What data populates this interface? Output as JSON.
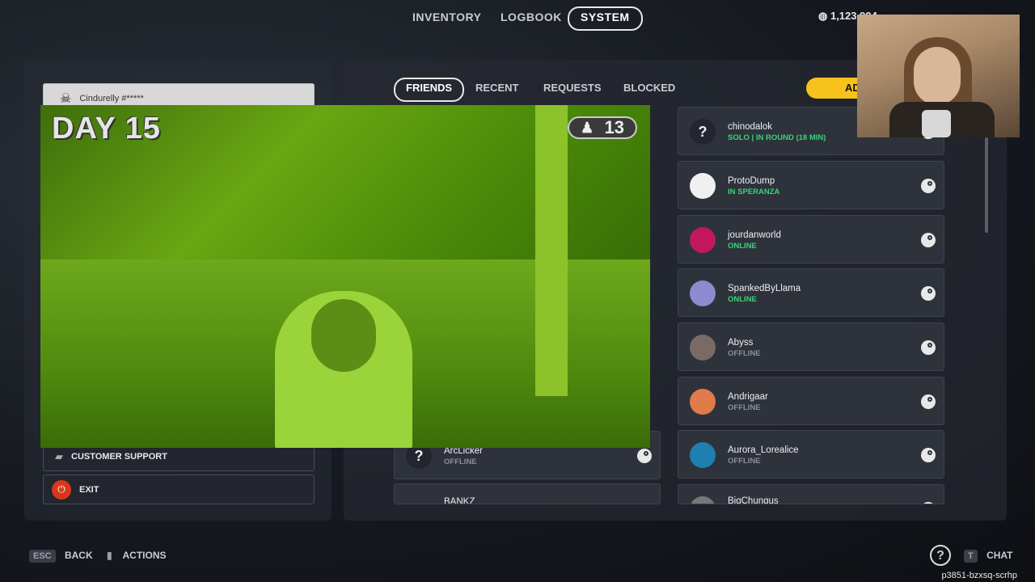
{
  "top_nav": {
    "tabs": [
      {
        "label": "INVENTORY",
        "active": false
      },
      {
        "label": "LOGBOOK",
        "active": false
      },
      {
        "label": "SYSTEM",
        "active": true
      }
    ],
    "currency": {
      "coins": "1,123,994"
    }
  },
  "left_panel": {
    "user": "Cindurelly #*****",
    "buttons": [
      {
        "label": "CUSTOMER SUPPORT",
        "icon": "chat-bubbles-icon"
      },
      {
        "label": "EXIT",
        "icon": "power-icon"
      }
    ]
  },
  "friends": {
    "tabs": [
      {
        "label": "FRIENDS",
        "active": true
      },
      {
        "label": "RECENT",
        "active": false
      },
      {
        "label": "REQUESTS",
        "active": false
      },
      {
        "label": "BLOCKED",
        "active": false
      }
    ],
    "add_label": "AD",
    "left_column": [
      {
        "name": "ArcLicker",
        "status": "OFFLINE"
      },
      {
        "name": "BANKZ",
        "status": ""
      }
    ],
    "right_column": [
      {
        "name": "chinodalok",
        "status": "SOLO | IN ROUND (18 MIN)",
        "status_color": "#3bd37a",
        "avatar": "?",
        "avatar_bg": "#23262e"
      },
      {
        "name": "ProtoDump",
        "status": "IN SPERANZA",
        "status_color": "#3bd37a",
        "avatar": "",
        "avatar_bg": "#f0f0f0"
      },
      {
        "name": "jourdanworld",
        "status": "ONLINE",
        "status_color": "#3bd37a",
        "avatar": "",
        "avatar_bg": "#c2185b"
      },
      {
        "name": "SpankedByLlama",
        "status": "ONLINE",
        "status_color": "#3bd37a",
        "avatar": "",
        "avatar_bg": "#8e8ad0"
      },
      {
        "name": "Abyss",
        "status": "OFFLINE",
        "status_color": "#8a8f99",
        "avatar": "",
        "avatar_bg": "#7a6a66"
      },
      {
        "name": "Andrigaar",
        "status": "OFFLINE",
        "status_color": "#8a8f99",
        "avatar": "",
        "avatar_bg": "#e07b4a"
      },
      {
        "name": "Aurora_Lorealice",
        "status": "OFFLINE",
        "status_color": "#8a8f99",
        "avatar": "",
        "avatar_bg": "#1e7fb0"
      },
      {
        "name": "BigChungus",
        "status": "",
        "status_color": "#8a8f99",
        "avatar": "",
        "avatar_bg": "#777"
      }
    ]
  },
  "overlay": {
    "day_label": "DAY 15",
    "count": "13"
  },
  "footer": {
    "back_key": "ESC",
    "back_label": "BACK",
    "actions_label": "ACTIONS",
    "chat_key": "T",
    "chat_label": "CHAT",
    "code": "p3851-bzxsq-scrhp"
  }
}
